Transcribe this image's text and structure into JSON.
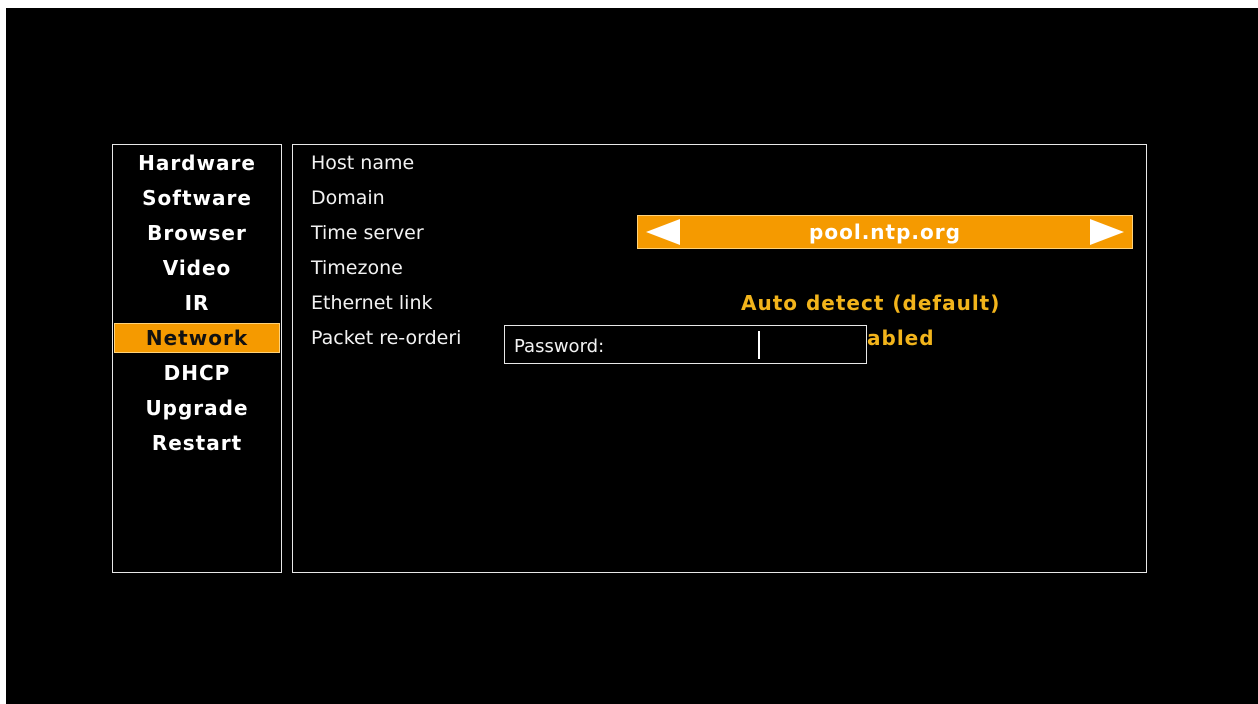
{
  "sidebar": {
    "items": [
      {
        "label": "Hardware"
      },
      {
        "label": "Software"
      },
      {
        "label": "Browser"
      },
      {
        "label": "Video"
      },
      {
        "label": "IR"
      },
      {
        "label": "Network",
        "active": true
      },
      {
        "label": "DHCP"
      },
      {
        "label": "Upgrade"
      },
      {
        "label": "Restart"
      }
    ]
  },
  "settings": {
    "rows": [
      {
        "label": "Host name"
      },
      {
        "label": "Domain"
      },
      {
        "label": "Time server",
        "value": "pool.ntp.org"
      },
      {
        "label": "Timezone"
      },
      {
        "label": "Ethernet link",
        "value": "Auto detect (default)"
      },
      {
        "label": "Packet re-orderi",
        "value": "abled"
      }
    ]
  },
  "dialog": {
    "label": "Password:",
    "value": ""
  },
  "colors": {
    "background": "#000000",
    "accent": "#f59a00",
    "value_text": "#f2b41b",
    "border": "#e8e8e8"
  },
  "icons": {
    "selector_left": "triangle-left-icon",
    "selector_right": "triangle-right-icon"
  }
}
